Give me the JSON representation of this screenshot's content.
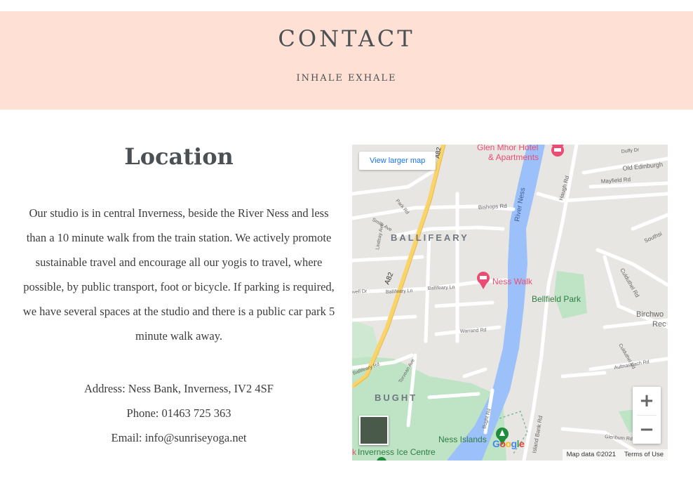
{
  "hero": {
    "title": "CONTACT",
    "subtitle": "INHALE EXHALE",
    "background": "#ffe0d4"
  },
  "location": {
    "heading": "Location",
    "description": "Our studio is in central Inverness, beside the River Ness and less than a 10 minute walk from the train station. We actively promote sustainable travel and encourage all our yogis to travel, where possible, by public transport, foot or bicycle. If parking is required, we have several spaces at the studio and there is a public car park 5 minute walk away.",
    "address": "Address: Ness Bank, Inverness, IV2 4SF",
    "phone": "Phone: 01463 725 363",
    "email": "Email: info@sunriseyoga.net"
  },
  "map": {
    "view_larger": "View larger map",
    "zoom_in": "+",
    "zoom_out": "−",
    "map_data": "Map data ©2021",
    "terms": "Terms of Use",
    "labels": {
      "hotel_line1": "Glen Mhor Hotel",
      "hotel_line2": "& Apartments",
      "ballifeary": "BALLIFEARY",
      "bught": "BUGHT",
      "ness_walk": "Ness Walk",
      "bellfield_park": "Bellfield Park",
      "ness_islands": "Ness Islands",
      "ice_centre": "Inverness Ice Centre",
      "river_ness": "River Ness",
      "a82": "A82",
      "a82_top": "A82",
      "bishops_rd": "Bishops Rd",
      "haugh_rd": "Haugh Rd",
      "old_edinburgh": "Old Edinburgh",
      "duffy_dr": "Duffy Dr",
      "mayfield_rd": "Mayfield Rd",
      "park_rd": "Park Rd",
      "smith_ave": "Smith Ave",
      "lindsay_ave": "Lindsay Ave",
      "ballifeary_ln": "Ballifeary Ln",
      "ballifeary_ln2": "Ballifeary Ln",
      "ballifeary_rd": "Ballifeary Rd",
      "warrand_rd": "Warrand Rd",
      "torvean_ave": "Torvean Ave",
      "bught_rd": "Bught Rd",
      "island_bank_rd": "Island Bank Rd",
      "culduthel_rd": "Culduthel Rd",
      "southside": "Southsi",
      "birchwood": "Birchwo",
      "rec": "Rec",
      "aultnaskiach": "Aultnaskiach Rd",
      "glenburn_rd": "Glenburn Rd",
      "culduthel_rd2": "Culduthel Rd",
      "ness_bank_dr": "well Dr",
      "google": "Google",
      "k": "k"
    },
    "colors": {
      "water": "#9cc0f9",
      "park": "#bfe3c5",
      "road": "#ffffff",
      "highway": "#f9d36b",
      "poi": "#ea4d74",
      "park_pin": "#1e8e3e"
    }
  }
}
